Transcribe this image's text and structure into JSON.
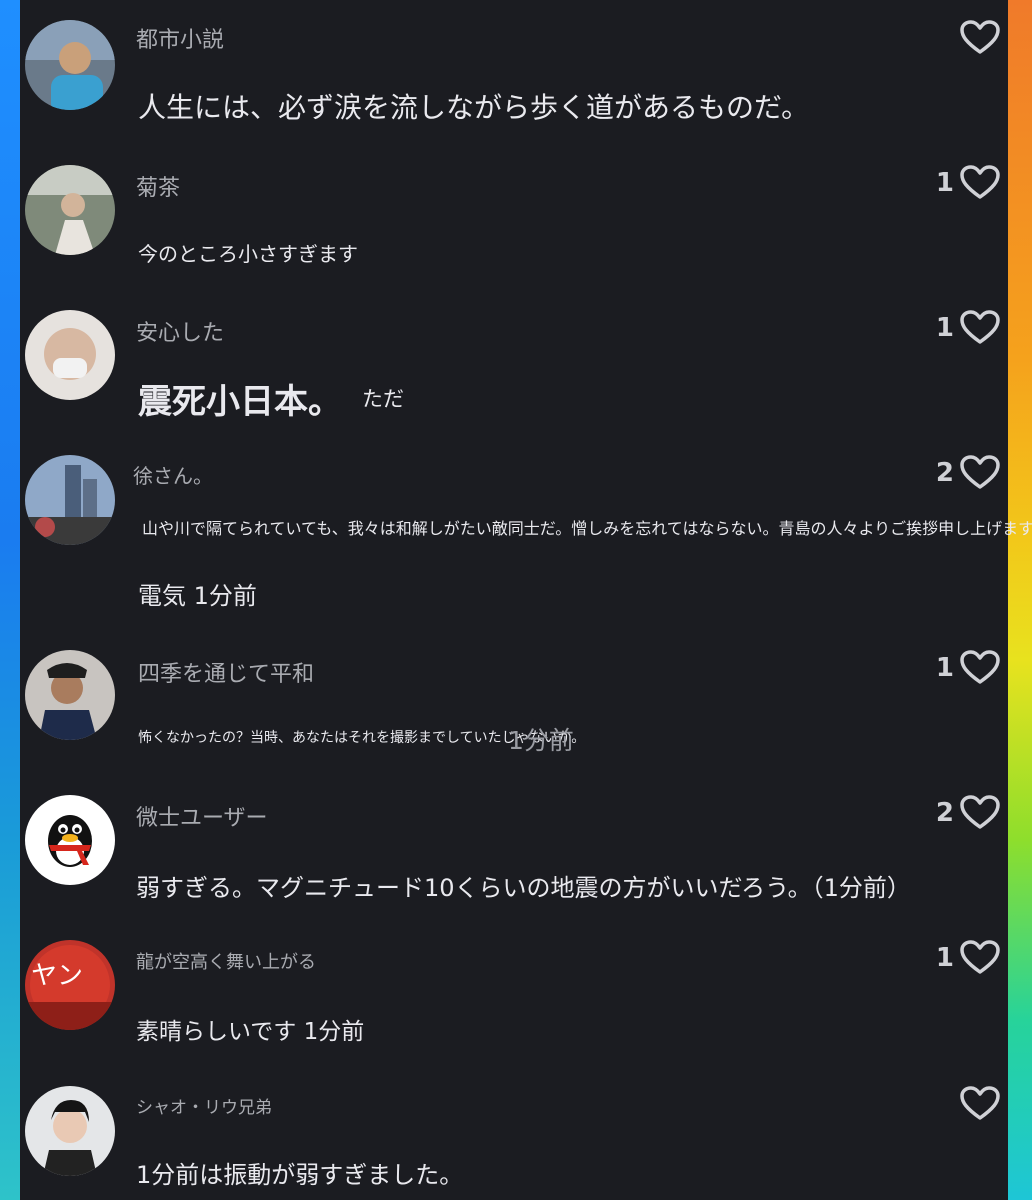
{
  "comments": [
    {
      "user": "都市小説",
      "text": "人生には、必ず涙を流しながら歩く道があるものだ。",
      "likes": ""
    },
    {
      "user": "菊茶",
      "text": "今のところ小さすぎます",
      "likes": "1"
    },
    {
      "user": "安心した",
      "text": "震死小日本。",
      "text2": "ただ",
      "likes": "1"
    },
    {
      "user": "徐さん。",
      "text": "山や川で隔てられていても、我々は和解しがたい敵同士だ。憎しみを忘れてはならない。青島の人々よりご挨拶申し上げます。",
      "text2": "電気 1分前",
      "likes": "2"
    },
    {
      "user": "四季を通じて平和",
      "text": "怖くなかったの？当時、あなたはそれを撮影までしていたじゃないか。",
      "time": "1分前",
      "likes": "1"
    },
    {
      "user": "微士ユーザー",
      "text": "弱すぎる。マグニチュード10くらいの地震の方がいいだろう。（1分前）",
      "likes": "2"
    },
    {
      "user": "龍が空高く舞い上がる",
      "avatar_text": "ヤン",
      "text": "素晴らしいです 1分前",
      "likes": "1"
    },
    {
      "user": "シャオ・リウ兄弟",
      "text": "1分前は振動が弱すぎました。",
      "likes": ""
    }
  ],
  "colors": {
    "background": "#1b1c21",
    "text": "#e9e9ee",
    "username": "#a9abb1",
    "heart": "#d0d1d6"
  }
}
